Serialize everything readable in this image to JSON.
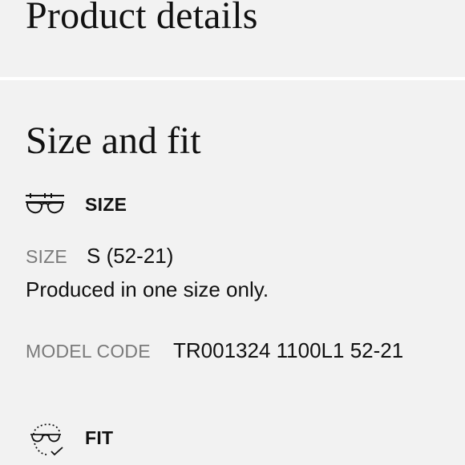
{
  "header": {
    "title": "Product details"
  },
  "section": {
    "title": "Size and fit"
  },
  "size": {
    "icon": "glasses-icon",
    "heading": "SIZE",
    "label": "SIZE",
    "value": "S (52-21)",
    "note": "Produced in one size only."
  },
  "model": {
    "label": "MODEL CODE",
    "value": "TR001324 1100L1 52-21"
  },
  "fit": {
    "icon": "face-fit-icon",
    "heading": "FIT"
  },
  "colors": {
    "background": "#f2f2f2",
    "divider": "#ffffff",
    "text": "#111111",
    "muted": "#7a7a7a"
  }
}
